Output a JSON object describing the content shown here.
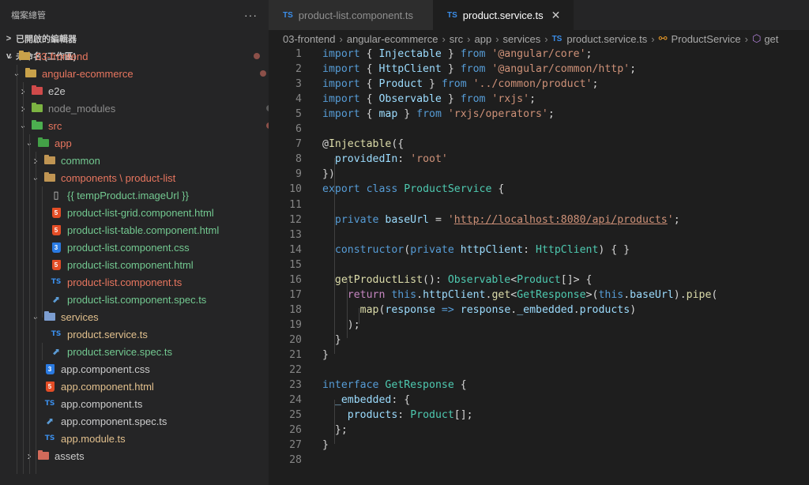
{
  "sidebar": {
    "title": "檔案總管",
    "more": "···",
    "open_editors": "已開啟的編輯器",
    "workspace": "未命名 (工作區)"
  },
  "tree": [
    {
      "name": "03-frontend",
      "depth": 1,
      "chev": "v",
      "icon": "folder-special",
      "color": "c-red",
      "badge": "",
      "dot": "dot-red"
    },
    {
      "name": "angular-ecommerce",
      "depth": 2,
      "chev": "v",
      "icon": "folder-special",
      "color": "c-red",
      "badge": "",
      "dot": "dot-red"
    },
    {
      "name": "e2e",
      "depth": 3,
      "chev": ">",
      "icon": "folder-e2e",
      "color": "c-plain",
      "badge": "",
      "dot": ""
    },
    {
      "name": "node_modules",
      "depth": 3,
      "chev": ">",
      "icon": "folder-node",
      "color": "c-dim",
      "badge": "",
      "dot": "dot-gray"
    },
    {
      "name": "src",
      "depth": 3,
      "chev": "v",
      "icon": "folder-src",
      "color": "c-red",
      "badge": "",
      "dot": "dot-red"
    },
    {
      "name": "app",
      "depth": 4,
      "chev": "v",
      "icon": "folder-app",
      "color": "c-red",
      "badge": "",
      "dot": "dot-red"
    },
    {
      "name": "common",
      "depth": 5,
      "chev": ">",
      "icon": "folder",
      "color": "c-green",
      "badge": "",
      "dot": "dot-green"
    },
    {
      "name": "components \\ product-list",
      "depth": 5,
      "chev": "v",
      "icon": "folder-open",
      "color": "c-red",
      "badge": "",
      "dot": "dot-red"
    },
    {
      "name": "{{ tempProduct.imageUrl }}",
      "depth": 6,
      "chev": "",
      "icon": "file",
      "color": "c-green",
      "badge": "U",
      "dot": ""
    },
    {
      "name": "product-list-grid.component.html",
      "depth": 6,
      "chev": "",
      "icon": "html",
      "color": "c-green",
      "badge": "U",
      "dot": ""
    },
    {
      "name": "product-list-table.component.html",
      "depth": 6,
      "chev": "",
      "icon": "html",
      "color": "c-green",
      "badge": "U",
      "dot": ""
    },
    {
      "name": "product-list.component.css",
      "depth": 6,
      "chev": "",
      "icon": "css",
      "color": "c-green",
      "badge": "U",
      "dot": ""
    },
    {
      "name": "product-list.component.html",
      "depth": 6,
      "chev": "",
      "icon": "html",
      "color": "c-green",
      "badge": "U",
      "dot": ""
    },
    {
      "name": "product-list.component.ts",
      "depth": 6,
      "chev": "",
      "icon": "ts",
      "color": "c-red",
      "badge": "2, U",
      "dot": ""
    },
    {
      "name": "product-list.component.spec.ts",
      "depth": 6,
      "chev": "",
      "icon": "spec",
      "color": "c-green",
      "badge": "U",
      "dot": ""
    },
    {
      "name": "services",
      "depth": 5,
      "chev": "v",
      "icon": "folder-services",
      "color": "c-yellow",
      "badge": "",
      "dot": "dot-yellow"
    },
    {
      "name": "product.service.ts",
      "depth": 6,
      "chev": "",
      "icon": "ts",
      "color": "c-yellow",
      "badge": "1, U",
      "dot": ""
    },
    {
      "name": "product.service.spec.ts",
      "depth": 6,
      "chev": "",
      "icon": "spec",
      "color": "c-green",
      "badge": "U",
      "dot": ""
    },
    {
      "name": "app.component.css",
      "depth": 5,
      "chev": "",
      "icon": "css",
      "color": "c-plain",
      "badge": "",
      "dot": ""
    },
    {
      "name": "app.component.html",
      "depth": 5,
      "chev": "",
      "icon": "html",
      "color": "c-orange",
      "badge": "M",
      "dot": ""
    },
    {
      "name": "app.component.ts",
      "depth": 5,
      "chev": "",
      "icon": "ts",
      "color": "c-plain",
      "badge": "",
      "dot": ""
    },
    {
      "name": "app.component.spec.ts",
      "depth": 5,
      "chev": "",
      "icon": "spec",
      "color": "c-plain",
      "badge": "",
      "dot": ""
    },
    {
      "name": "app.module.ts",
      "depth": 5,
      "chev": "",
      "icon": "ts",
      "color": "c-orange",
      "badge": "M",
      "dot": ""
    },
    {
      "name": "assets",
      "depth": 4,
      "chev": ">",
      "icon": "folder-assets",
      "color": "c-plain",
      "badge": "",
      "dot": "dot-green"
    }
  ],
  "tabs": [
    {
      "label": "product-list.component.ts",
      "lang": "TS",
      "active": false
    },
    {
      "label": "product.service.ts",
      "lang": "TS",
      "active": true,
      "close": "✕"
    }
  ],
  "breadcrumb": [
    "03-frontend",
    "angular-ecommerce",
    "src",
    "app",
    "services",
    "product.service.ts",
    "ProductService",
    "get"
  ],
  "breadcrumb_ts_label": "TS",
  "code": [
    [
      [
        "k",
        "import"
      ],
      [
        "p",
        " { "
      ],
      [
        "v",
        "Injectable"
      ],
      [
        "p",
        " } "
      ],
      [
        "k",
        "from"
      ],
      [
        "p",
        " "
      ],
      [
        "s",
        "'@angular/core'"
      ],
      [
        "p",
        ";"
      ]
    ],
    [
      [
        "k",
        "import"
      ],
      [
        "p",
        " { "
      ],
      [
        "v",
        "HttpClient"
      ],
      [
        "p",
        " } "
      ],
      [
        "k",
        "from"
      ],
      [
        "p",
        " "
      ],
      [
        "s",
        "'@angular/common/http'"
      ],
      [
        "p",
        ";"
      ]
    ],
    [
      [
        "k",
        "import"
      ],
      [
        "p",
        " { "
      ],
      [
        "v",
        "Product"
      ],
      [
        "p",
        " } "
      ],
      [
        "k",
        "from"
      ],
      [
        "p",
        " "
      ],
      [
        "s",
        "'../common/product'"
      ],
      [
        "p",
        ";"
      ]
    ],
    [
      [
        "k",
        "import"
      ],
      [
        "p",
        " { "
      ],
      [
        "v",
        "Observable"
      ],
      [
        "p",
        " } "
      ],
      [
        "k",
        "from"
      ],
      [
        "p",
        " "
      ],
      [
        "s",
        "'rxjs'"
      ],
      [
        "p",
        ";"
      ]
    ],
    [
      [
        "k",
        "import"
      ],
      [
        "p",
        " { "
      ],
      [
        "v",
        "map"
      ],
      [
        "p",
        " } "
      ],
      [
        "k",
        "from"
      ],
      [
        "p",
        " "
      ],
      [
        "s",
        "'rxjs/operators'"
      ],
      [
        "p",
        ";"
      ]
    ],
    [],
    [
      [
        "p",
        "@"
      ],
      [
        "f",
        "Injectable"
      ],
      [
        "p",
        "({"
      ]
    ],
    [
      [
        "p",
        "  "
      ],
      [
        "v",
        "providedIn"
      ],
      [
        "p",
        ": "
      ],
      [
        "s",
        "'root'"
      ]
    ],
    [
      [
        "p",
        "})"
      ]
    ],
    [
      [
        "k",
        "export"
      ],
      [
        "p",
        " "
      ],
      [
        "k",
        "class"
      ],
      [
        "p",
        " "
      ],
      [
        "t",
        "ProductService"
      ],
      [
        "p",
        " {"
      ]
    ],
    [],
    [
      [
        "p",
        "  "
      ],
      [
        "k",
        "private"
      ],
      [
        "p",
        " "
      ],
      [
        "v",
        "baseUrl"
      ],
      [
        "p",
        " = "
      ],
      [
        "s",
        "'"
      ],
      [
        "url",
        "http://localhost:8080/api/products"
      ],
      [
        "s",
        "'"
      ],
      [
        "p",
        ";"
      ]
    ],
    [],
    [
      [
        "p",
        "  "
      ],
      [
        "k",
        "constructor"
      ],
      [
        "p",
        "("
      ],
      [
        "k",
        "private"
      ],
      [
        "p",
        " "
      ],
      [
        "v",
        "httpClient"
      ],
      [
        "p",
        ": "
      ],
      [
        "t",
        "HttpClient"
      ],
      [
        "p",
        ") { }"
      ]
    ],
    [],
    [
      [
        "p",
        "  "
      ],
      [
        "f",
        "getProductList"
      ],
      [
        "p",
        "(): "
      ],
      [
        "t",
        "Observable"
      ],
      [
        "p",
        "<"
      ],
      [
        "t",
        "Product"
      ],
      [
        "p",
        "[]> {"
      ]
    ],
    [
      [
        "p",
        "    "
      ],
      [
        "kc",
        "return"
      ],
      [
        "p",
        " "
      ],
      [
        "k",
        "this"
      ],
      [
        "p",
        "."
      ],
      [
        "v",
        "httpClient"
      ],
      [
        "p",
        "."
      ],
      [
        "f",
        "get"
      ],
      [
        "p",
        "<"
      ],
      [
        "t",
        "GetResponse"
      ],
      [
        "p",
        ">("
      ],
      [
        "k",
        "this"
      ],
      [
        "p",
        "."
      ],
      [
        "v",
        "baseUrl"
      ],
      [
        "p",
        ")."
      ],
      [
        "f",
        "pipe"
      ],
      [
        "p",
        "("
      ]
    ],
    [
      [
        "p",
        "      "
      ],
      [
        "f",
        "map"
      ],
      [
        "p",
        "("
      ],
      [
        "v",
        "response"
      ],
      [
        "p",
        " "
      ],
      [
        "k",
        "=>"
      ],
      [
        "p",
        " "
      ],
      [
        "v",
        "response"
      ],
      [
        "p",
        "."
      ],
      [
        "v",
        "_embedded"
      ],
      [
        "p",
        "."
      ],
      [
        "v",
        "products"
      ],
      [
        "p",
        ")"
      ]
    ],
    [
      [
        "p",
        "    );"
      ]
    ],
    [
      [
        "p",
        "  }"
      ]
    ],
    [
      [
        "p",
        "}"
      ]
    ],
    [],
    [
      [
        "k",
        "interface"
      ],
      [
        "p",
        " "
      ],
      [
        "t",
        "GetResponse"
      ],
      [
        "p",
        " {"
      ]
    ],
    [
      [
        "p",
        "  "
      ],
      [
        "v",
        "_embedded"
      ],
      [
        "p",
        ": {"
      ]
    ],
    [
      [
        "p",
        "    "
      ],
      [
        "v",
        "products"
      ],
      [
        "p",
        ": "
      ],
      [
        "t",
        "Product"
      ],
      [
        "p",
        "[];"
      ]
    ],
    [
      [
        "p",
        "  };"
      ]
    ],
    [
      [
        "p",
        "}"
      ]
    ],
    []
  ],
  "line_numbers": [
    "1",
    "2",
    "3",
    "4",
    "5",
    "6",
    "7",
    "8",
    "9",
    "10",
    "11",
    "12",
    "13",
    "14",
    "15",
    "16",
    "17",
    "18",
    "19",
    "20",
    "21",
    "22",
    "23",
    "24",
    "25",
    "26",
    "27",
    "28"
  ],
  "colors": {
    "editor_bg": "#1e1e1e",
    "sidebar_bg": "#252526",
    "git_untracked": "#73c991",
    "git_error": "#e8765f",
    "git_modified": "#e2c08d"
  }
}
